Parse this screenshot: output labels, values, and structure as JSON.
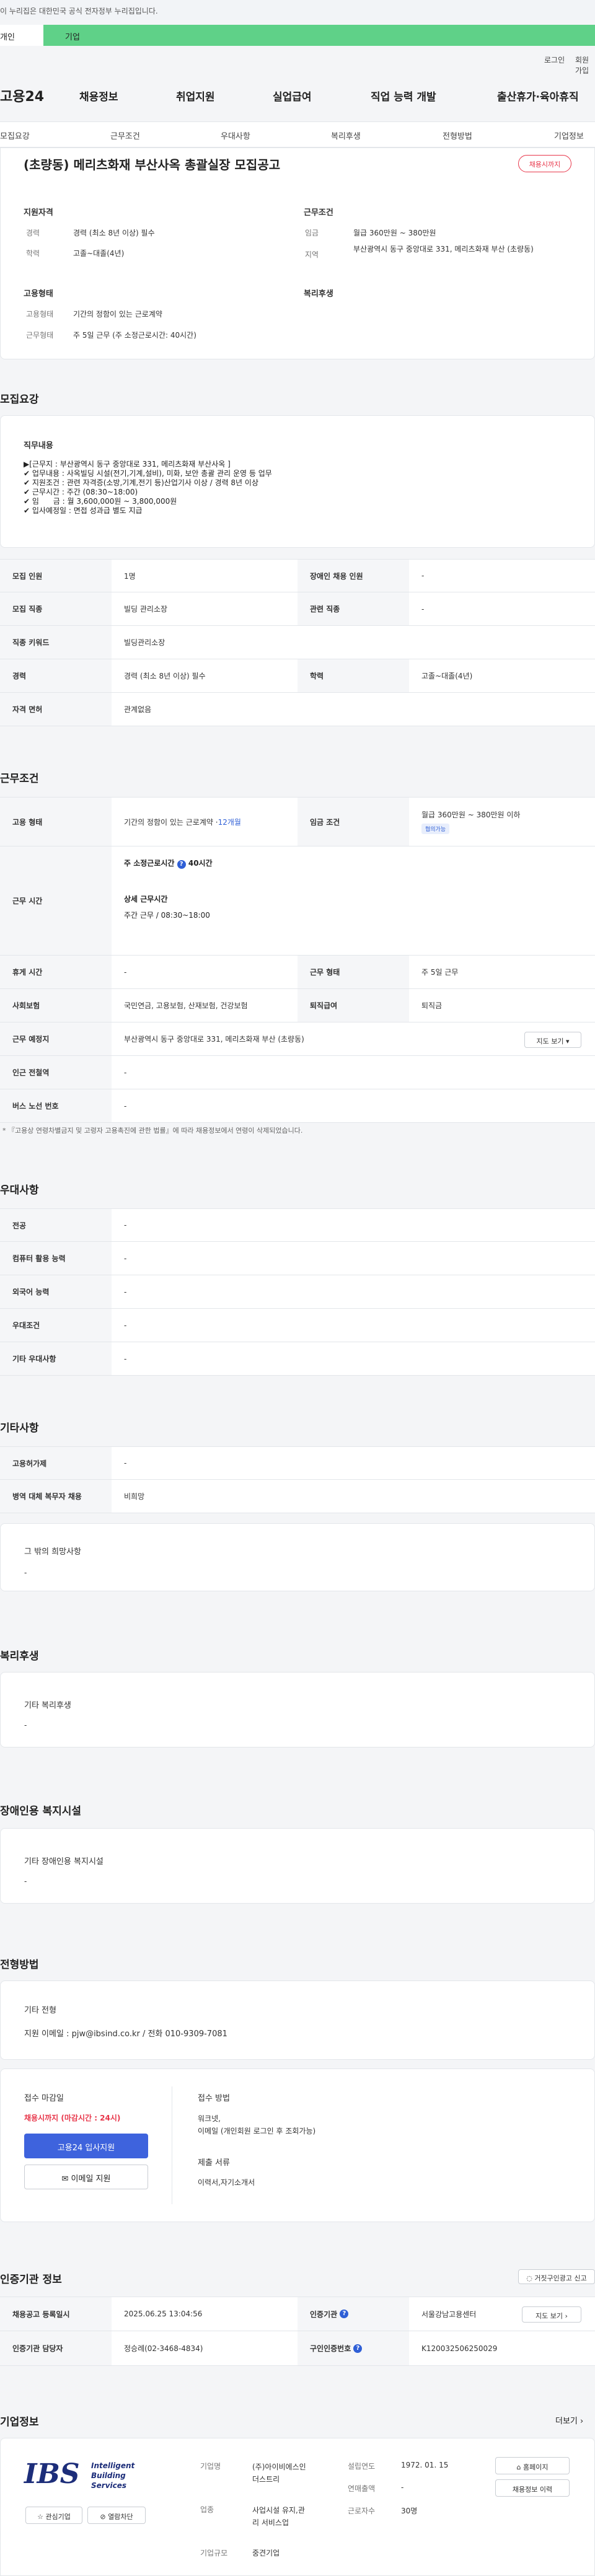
{
  "gov_banner": "이 누리집은 대한민국 공식 전자정부 누리집입니다.",
  "member_tabs": [
    "개인",
    "기업"
  ],
  "util": {
    "login": "로그인",
    "join": "회원가입"
  },
  "logo": "고용24",
  "gnb": [
    "채용정보",
    "취업지원",
    "실업급여",
    "직업 능력 개발",
    "출산휴가·육아휴직"
  ],
  "subnav": [
    "모집요강",
    "근무조건",
    "우대사항",
    "복리후생",
    "전형방법",
    "기업정보"
  ],
  "job": {
    "title": "(초량동) 메리츠화재 부산사옥 총괄실장 모집공고",
    "status": "채용시까지",
    "qual_title": "지원자격",
    "career_k": "경력",
    "career_v": "경력 (최소 8년 이상) 필수",
    "edu_k": "학력",
    "edu_v": "고졸~대졸(4년)",
    "cond_title": "근무조건",
    "wage_k": "임금",
    "wage_v": "월급 360만원 ~ 380만원",
    "area_k": "지역",
    "area_v": "부산광역시 동구 중앙대로 331, 메리츠화재 부산 (초량동)",
    "emp_title": "고용형태",
    "emptype_k": "고용형태",
    "emptype_v": "기간의 정함이 있는 근로계약",
    "worktype_k": "근무형태",
    "worktype_v": "주 5일 근무 (주 소정근로시간: 40시간)",
    "welfare_title": "복리후생"
  },
  "recruit": {
    "section": "모집요강",
    "duty_title": "직무내용",
    "duty_text": "▶[근무지 : 부산광역시 동구 중앙대로 331, 메리츠화재 부산사옥 ]\n✔ 업무내용 : 사옥빌딩 시설(전기,기계,설비), 미화, 보안 총괄 관리 운영 등 업무\n✔ 지원조건 : 관련 자격증(소방,기계,전기 등)산업기사 이상 / 경력 8년 이상\n✔ 근무시간 : 주간 (08:30~18:00)\n✔ 임      금 : 월 3,600,000원 ~ 3,800,000원\n✔ 입사예정일 : 면접 성과급 별도 지급",
    "rows": [
      {
        "k1": "모집 인원",
        "v1": "1명",
        "k2": "장애인 채용 인원",
        "v2": "-"
      },
      {
        "k1": "모집 직종",
        "v1": "빌딩 관리소장",
        "k2": "관련 직종",
        "v2": "-"
      },
      {
        "k1": "직종 키워드",
        "v1": "빌딩관리소장"
      },
      {
        "k1": "경력",
        "v1": "경력 (최소 8년 이상) 필수",
        "k2": "학력",
        "v2": "고졸~대졸(4년)"
      },
      {
        "k1": "자격 면허",
        "v1": "관계없음"
      }
    ]
  },
  "conditions": {
    "section": "근무조건",
    "emp_k": "고용 형태",
    "emp_v": "기간의 정함이 있는 근로계약 · ",
    "emp_months": "12개월",
    "wage_k": "임금 조건",
    "wage_v": "월급 360만원 ~ 380만원 이하",
    "wage_chip": "협의가능",
    "hours_k": "근무 시간",
    "hours_title": "주 소정근로시간",
    "hours_value": "40시간",
    "detail_title": "상세 근무시간",
    "detail_value": "주간 근무 / 08:30~18:00",
    "rest_k": "휴게 시간",
    "rest_v": "-",
    "form_k": "근무 형태",
    "form_v": "주 5일 근무",
    "ins_k": "사회보험",
    "ins_v": "국민연금, 고용보험, 산재보험, 건강보험",
    "sev_k": "퇴직급여",
    "sev_v": "퇴직금",
    "place_k": "근무 예정지",
    "place_v": "부산광역시 동구 중앙대로 331, 메리츠화재 부산 (초량동)",
    "map_btn": "지도 보기",
    "subway_k": "인근 전철역",
    "subway_v": "-",
    "bus_k": "버스 노선 번호",
    "bus_v": "-",
    "note": "* 『고용상 연령차별금지 및 고령자 고용촉진에 관한 법률』에 따라 채용정보에서 연령이 삭제되었습니다."
  },
  "pref": {
    "section": "우대사항",
    "rows": [
      {
        "k": "전공",
        "v": "-"
      },
      {
        "k": "컴퓨터 활용 능력",
        "v": "-"
      },
      {
        "k": "외국어 능력",
        "v": "-"
      },
      {
        "k": "우대조건",
        "v": "-"
      },
      {
        "k": "기타 우대사항",
        "v": "-"
      }
    ]
  },
  "etc": {
    "section": "기타사항",
    "rows": [
      {
        "k": "고용허가제",
        "v": "-"
      },
      {
        "k": "병역 대체 복무자 채용",
        "v": "비희망"
      }
    ],
    "hope_title": "그 밖의 희망사항",
    "hope_v": "-"
  },
  "welfare": {
    "section": "복리후생",
    "title": "기타 복리후생",
    "v": "-"
  },
  "disabled": {
    "section": "장애인용 복지시설",
    "title": "기타 장애인용 복지시설",
    "v": "-"
  },
  "screening": {
    "section": "전형방법",
    "title": "기타 전형",
    "v": "지원 이메일 : pjw@ibsind.co.kr / 전화 010-9309-7081",
    "deadline_title": "접수 마감일",
    "deadline_v": "채용시까지 (마감시간 : 24시)",
    "apply_btn": "고용24 입사지원",
    "email_btn": "이메일 지원",
    "method_title": "접수 방법",
    "method_v": "워크넷,\n이메일 (개인회원 로그인 후 조회가능)",
    "docs_title": "제출 서류",
    "docs_v": "이력서,자기소개서"
  },
  "auth": {
    "section": "인증기관 정보",
    "report_btn": "거짓구인광고 신고",
    "reg_k": "채용공고 등록일시",
    "reg_v": "2025.06.25 13:04:56",
    "org_k": "인증기관",
    "org_v": "서울강남고용센터",
    "map_btn": "지도 보기",
    "mgr_k": "인증기관 담당자",
    "mgr_v": "정승례(02-3468-4834)",
    "num_k": "구인인증번호",
    "num_v": "K120032506250029"
  },
  "company": {
    "section": "기업정보",
    "more": "더보기",
    "logo_big": "IBS",
    "logo_text": "Intelligent\nBuilding\nServices",
    "fav_btn": "관심기업",
    "block_btn": "열람차단",
    "name_k": "기업명",
    "name_v": "(주)아이비에스인\n더스트리",
    "ind_k": "업종",
    "ind_v": "사업시설 유지,관\n리 서비스업",
    "size_k": "기업규모",
    "size_v": "중견기업",
    "est_k": "설립연도",
    "est_v": "1972. 01. 15",
    "sales_k": "연매출액",
    "sales_v": "-",
    "emp_k": "근로자수",
    "emp_v": "30명",
    "home_btn": "홈페이지",
    "jobs_btn": "채용정보 이력"
  },
  "colors": {
    "accent": "#2f5fd6",
    "green": "#5fd188",
    "red": "#e8374b"
  }
}
